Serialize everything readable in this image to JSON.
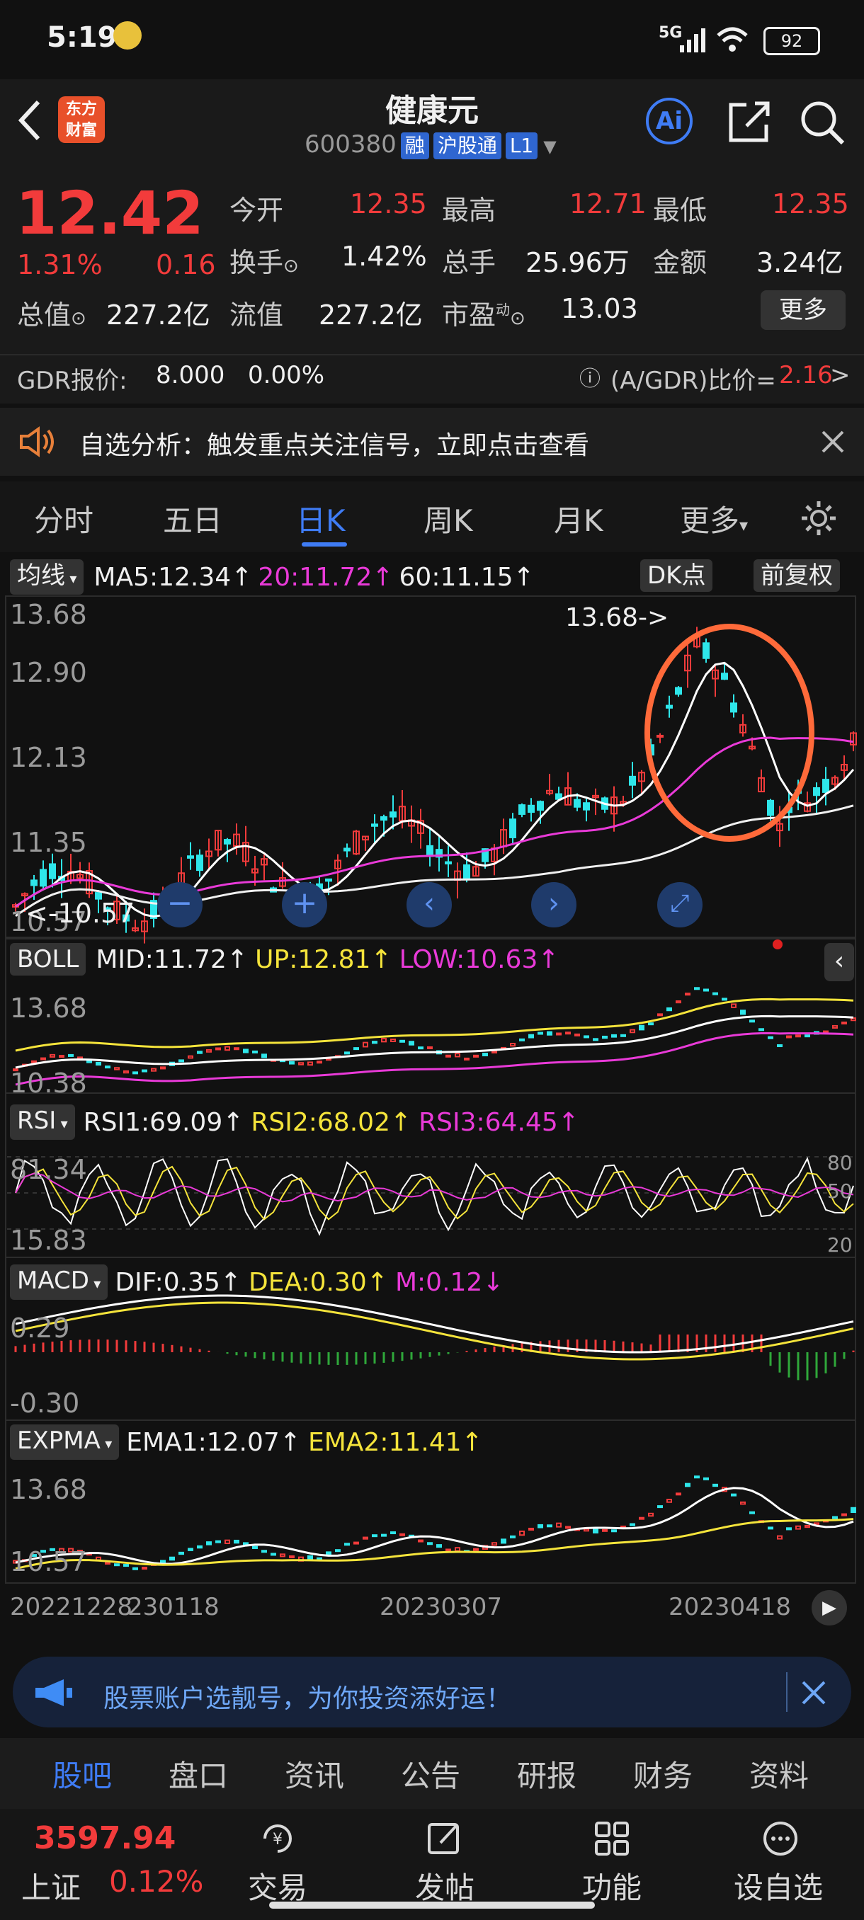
{
  "status_bar": {
    "time": "5:19",
    "network": "5G",
    "battery": "92"
  },
  "header": {
    "logo_line1": "东方",
    "logo_line2": "财富",
    "title": "健康元",
    "code": "600380",
    "tags": [
      "融",
      "沪股通",
      "L1"
    ],
    "ai_label": "Ai"
  },
  "quote": {
    "price": "12.42",
    "change_pct": "1.31%",
    "change_abs": "0.16",
    "fields": [
      {
        "label": "今开",
        "value": "12.35"
      },
      {
        "label": "最高",
        "value": "12.71"
      },
      {
        "label": "最低",
        "value": "12.35"
      },
      {
        "label": "换手",
        "value": "1.42%"
      },
      {
        "label": "总手",
        "value": "25.96万"
      },
      {
        "label": "金额",
        "value": "3.24亿"
      },
      {
        "label": "总值",
        "value": "227.2亿"
      },
      {
        "label": "流值",
        "value": "227.2亿"
      },
      {
        "label": "市盈",
        "value": "13.03"
      }
    ],
    "pe_superscript": "动",
    "more_button": "更多"
  },
  "gdr": {
    "label": "GDR报价:",
    "price": "8.000",
    "pct": "0.00%",
    "ratio_label": "(A/GDR)比价=",
    "ratio_value": "2.16",
    "arrow": ">"
  },
  "notice": {
    "text": "自选分析：触发重点关注信号，立即点击查看"
  },
  "tabs": {
    "items": [
      "分时",
      "五日",
      "日K",
      "周K",
      "月K",
      "更多"
    ],
    "active": "日K"
  },
  "colors": {
    "up": "#f23b3b",
    "down": "#2ee6ea",
    "ma5": "#ffffff",
    "ma20": "#e93ad8",
    "ma60": "#f0f0f0",
    "yellow": "#f5e43b",
    "active_tab": "#3f7cf5"
  },
  "main_panel": {
    "indicator": "均线",
    "ma5": "MA5:12.34",
    "ma20": "20:11.72",
    "ma60": "60:11.15",
    "dk_button": "DK点",
    "adjust_button": "前复权",
    "y_labels": [
      "13.68",
      "12.90",
      "12.13",
      "11.35",
      "10.57"
    ],
    "high_marker": "13.68->",
    "low_marker": "<-10.57"
  },
  "boll_panel": {
    "indicator": "BOLL",
    "mid": "MID:11.72",
    "up": "UP:12.81",
    "low": "LOW:10.63",
    "y_top": "13.68",
    "y_bottom": "10.38"
  },
  "rsi_panel": {
    "indicator": "RSI",
    "rsi1": "RSI1:69.09",
    "rsi2": "RSI2:68.02",
    "rsi3": "RSI3:64.45",
    "y_top": "81.34",
    "y_bottom": "15.83",
    "levels": [
      "80",
      "50",
      "20"
    ]
  },
  "macd_panel": {
    "indicator": "MACD",
    "dif": "DIF:0.35",
    "dea": "DEA:0.30",
    "m": "M:0.12",
    "y_top": "0.29",
    "y_bottom": "-0.30"
  },
  "expma_panel": {
    "indicator": "EXPMA",
    "ema1": "EMA1:12.07",
    "ema2": "EMA2:11.41",
    "y_top": "13.68",
    "y_bottom": "10.57"
  },
  "dates": [
    "20221228",
    "230118",
    "20230307",
    "20230418"
  ],
  "banner": {
    "text": "股票账户选靓号，为你投资添好运！"
  },
  "bottom_tabs": {
    "items": [
      "股吧",
      "盘口",
      "资讯",
      "公告",
      "研报",
      "财务",
      "资料"
    ],
    "active": "股吧"
  },
  "footer": {
    "index_value": "3597.94",
    "index_name": "上证",
    "index_change": "0.12%",
    "items": [
      "交易",
      "发帖",
      "功能",
      "设自选"
    ]
  }
}
